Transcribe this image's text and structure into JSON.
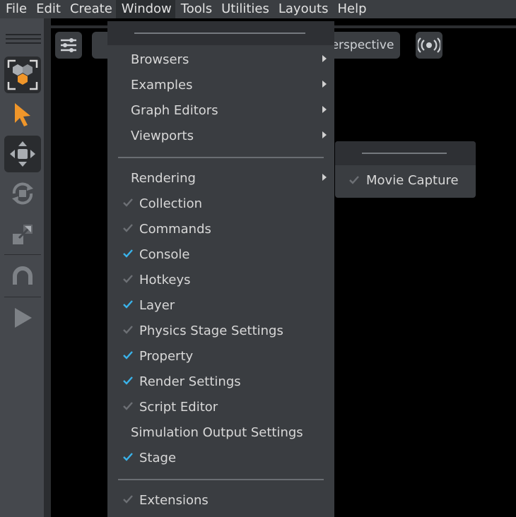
{
  "menubar": {
    "items": [
      "File",
      "Edit",
      "Create",
      "Window",
      "Tools",
      "Utilities",
      "Layouts",
      "Help"
    ]
  },
  "viewport": {
    "camera_label": "erspective"
  },
  "window_menu": {
    "items": [
      {
        "label": "Browsers",
        "submenu": true
      },
      {
        "label": "Examples",
        "submenu": true
      },
      {
        "label": "Graph Editors",
        "submenu": true
      },
      {
        "label": "Viewports",
        "submenu": true
      },
      {
        "label": "Rendering",
        "submenu": true
      },
      {
        "label": "Collection",
        "checked": false
      },
      {
        "label": "Commands",
        "checked": false
      },
      {
        "label": "Console",
        "checked": true
      },
      {
        "label": "Hotkeys",
        "checked": false
      },
      {
        "label": "Layer",
        "checked": true
      },
      {
        "label": "Physics Stage Settings",
        "checked": false
      },
      {
        "label": "Property",
        "checked": true
      },
      {
        "label": "Render Settings",
        "checked": true
      },
      {
        "label": "Script Editor",
        "checked": false
      },
      {
        "label": "Simulation Output Settings"
      },
      {
        "label": "Stage",
        "checked": true
      },
      {
        "label": "Extensions",
        "checked": false
      }
    ]
  },
  "rendering_submenu": {
    "items": [
      {
        "label": "Movie Capture",
        "checked": false
      }
    ]
  },
  "colors": {
    "check_on": "#3ab3ea",
    "check_off": "#6d7075",
    "accent_orange": "#f0962a"
  }
}
